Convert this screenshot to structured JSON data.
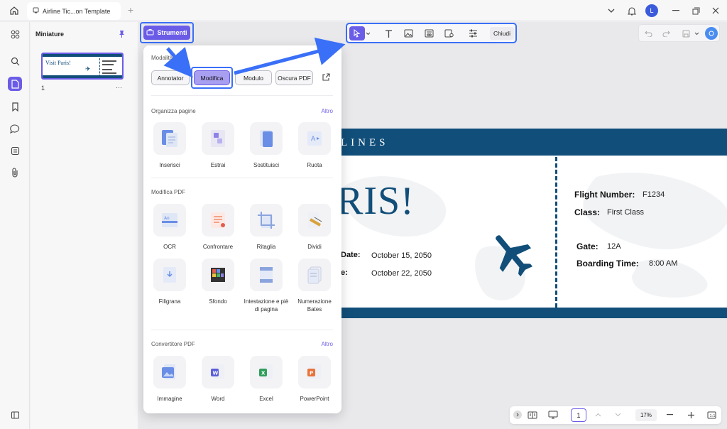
{
  "tab": {
    "title": "Airline Tic...on Template"
  },
  "user": {
    "initial": "L"
  },
  "thumbnails": {
    "title": "Miniature",
    "page_label": "1",
    "more": "···",
    "thumb_title": "Visit Paris!"
  },
  "tools_button": {
    "label": "Strumenti"
  },
  "toolbar": {
    "close_label": "Chiudi"
  },
  "popup": {
    "modes_title": "Modalità",
    "modes": [
      "Annotator",
      "Modifica",
      "Modulo",
      "Oscura PDF"
    ],
    "organize": {
      "title": "Organizza pagine",
      "more": "Altro",
      "items": [
        "Inserisci",
        "Estrai",
        "Sostituisci",
        "Ruota"
      ]
    },
    "edit": {
      "title": "Modifica PDF",
      "items": [
        "OCR",
        "Confrontare",
        "Ritaglia",
        "Dividi",
        "Filigrana",
        "Sfondo",
        "Intestazione e piè di pagina",
        "Numerazione Bates"
      ]
    },
    "convert": {
      "title": "Convertitore PDF",
      "more": "Altro",
      "items": [
        "Immagine",
        "Word",
        "Excel",
        "PowerPoint"
      ]
    }
  },
  "ticket": {
    "airline_text": "LINES",
    "headline": "RIS!",
    "date1_label": "Date:",
    "date1_value": "October 15, 2050",
    "date2_label": "e:",
    "date2_value": "October 22, 2050",
    "flight_label": "Flight Number:",
    "flight_value": "F1234",
    "class_label": "Class:",
    "class_value": "First Class",
    "gate_label": "Gate:",
    "gate_value": "12A",
    "boarding_label": "Boarding Time:",
    "boarding_value": "8:00 AM"
  },
  "bottom": {
    "page": "1",
    "zoom": "17%"
  },
  "colors": {
    "accent": "#6b5ce7",
    "highlight": "#3a6ff7",
    "ticket_blue": "#114e79"
  }
}
